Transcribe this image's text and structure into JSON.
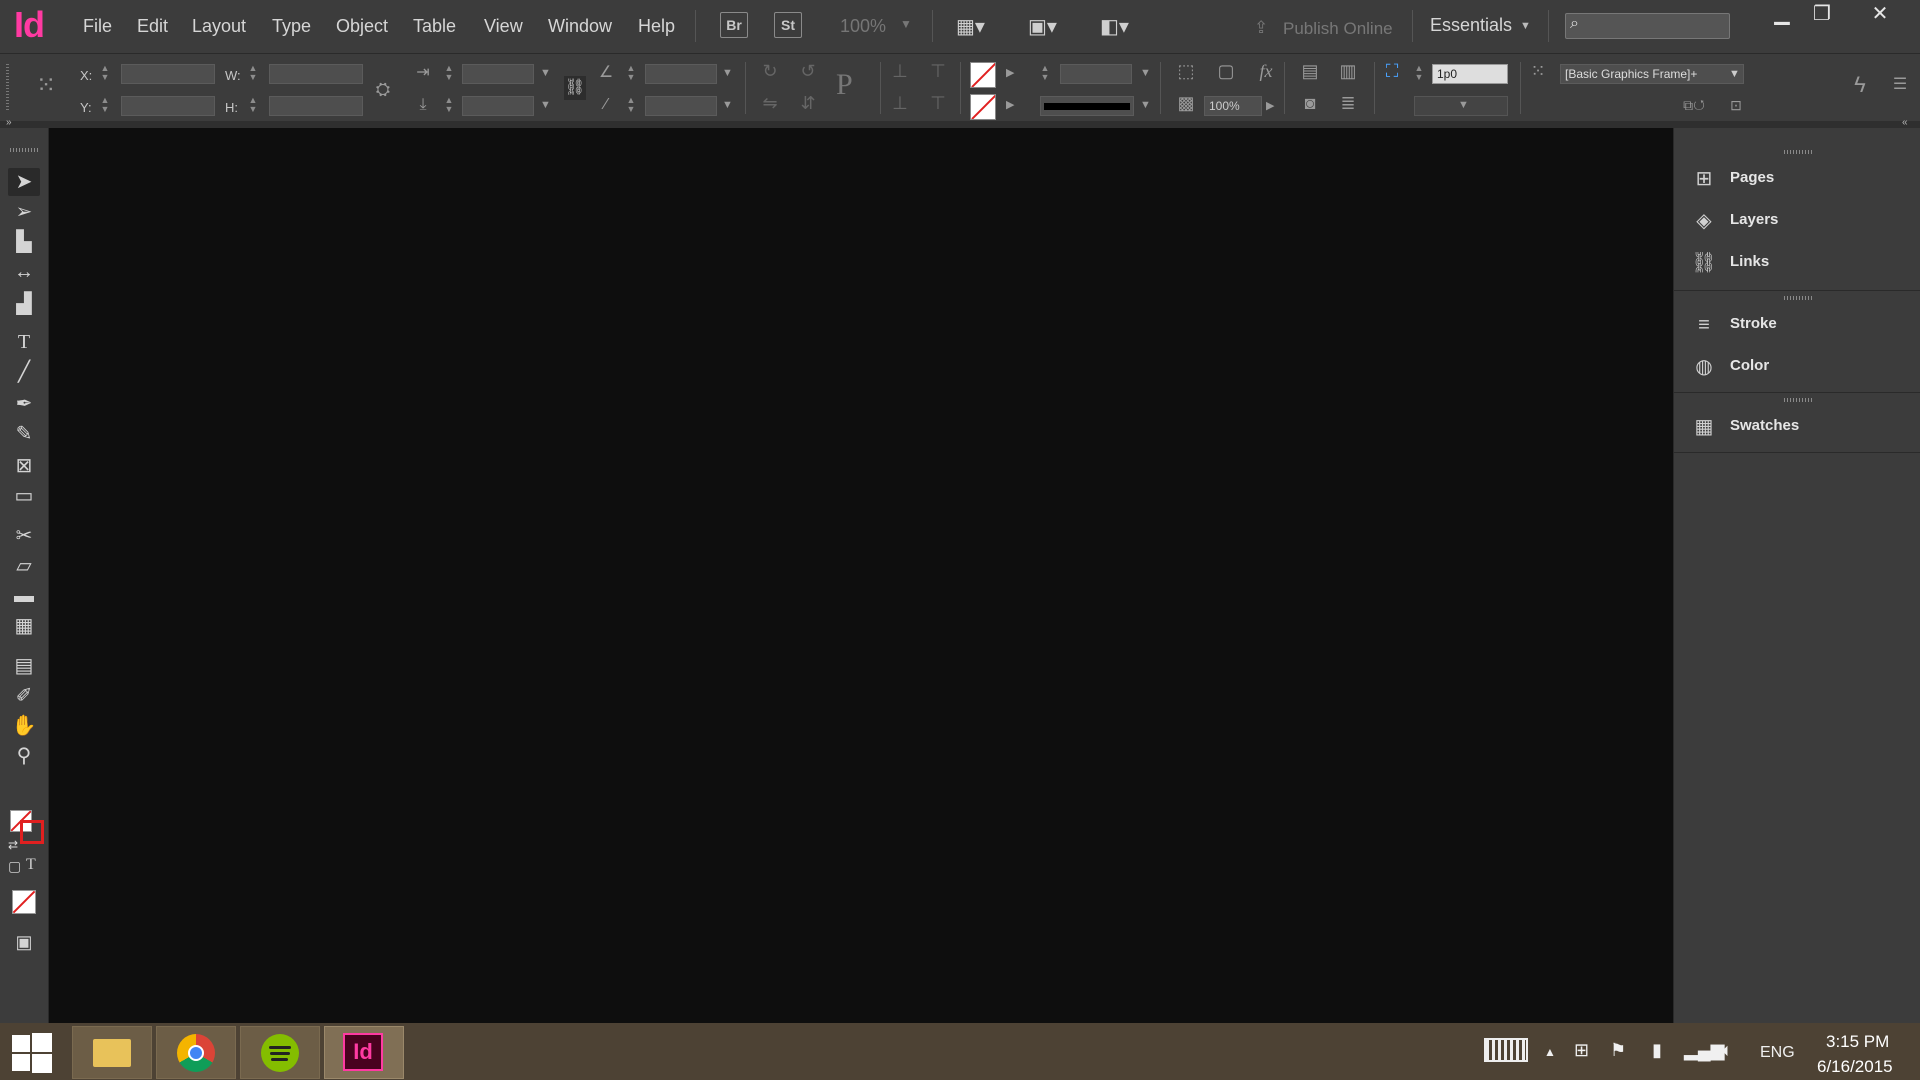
{
  "app": {
    "logo": "Id",
    "accent": "#ff3aa2"
  },
  "menu": [
    "File",
    "Edit",
    "Layout",
    "Type",
    "Object",
    "Table",
    "View",
    "Window",
    "Help"
  ],
  "toolbar": {
    "bridge": "Br",
    "stock": "St",
    "zoom": "100%",
    "publish": "Publish Online",
    "workspace": "Essentials"
  },
  "control": {
    "x_label": "X:",
    "y_label": "Y:",
    "w_label": "W:",
    "h_label": "H:",
    "stroke_weight": "1p0",
    "opacity": "100%",
    "object_style": "[Basic Graphics Frame]+"
  },
  "panels": [
    "Pages",
    "Layers",
    "Links",
    "Stroke",
    "Color",
    "Swatches"
  ],
  "taskbar": {
    "language": "ENG",
    "time": "3:15 PM",
    "date": "6/16/2015",
    "active_app": "Id"
  }
}
